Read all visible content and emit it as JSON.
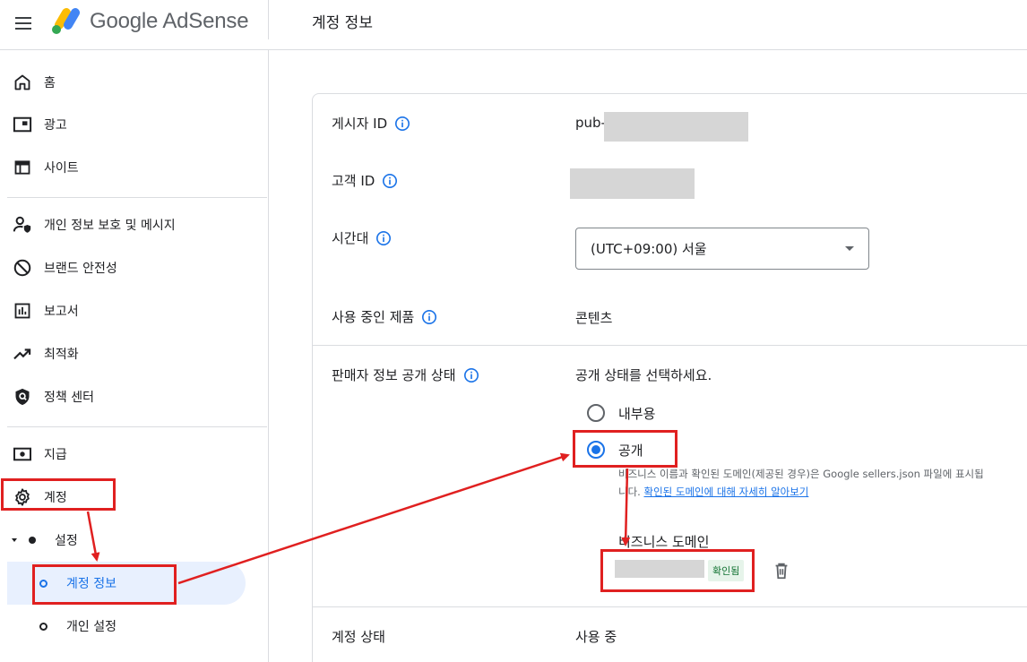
{
  "header": {
    "logo_text": "Google AdSense",
    "page_title": "계정 정보"
  },
  "sidebar": {
    "items": [
      {
        "label": "홈",
        "icon": "home-icon"
      },
      {
        "label": "광고",
        "icon": "ads-icon"
      },
      {
        "label": "사이트",
        "icon": "sites-icon"
      },
      {
        "label": "개인 정보 보호 및 메시지",
        "icon": "privacy-icon"
      },
      {
        "label": "브랜드 안전성",
        "icon": "block-icon"
      },
      {
        "label": "보고서",
        "icon": "reports-icon"
      },
      {
        "label": "최적화",
        "icon": "trending-icon"
      },
      {
        "label": "정책 센터",
        "icon": "policy-icon"
      },
      {
        "label": "지급",
        "icon": "payments-icon"
      },
      {
        "label": "계정",
        "icon": "gear-icon"
      }
    ],
    "settings_label": "설정",
    "sub_items": [
      {
        "label": "계정 정보",
        "active": true
      },
      {
        "label": "개인 설정",
        "active": false
      }
    ]
  },
  "card": {
    "publisher_id_label": "게시자 ID",
    "publisher_id_prefix": "pub-",
    "customer_id_label": "고객 ID",
    "timezone_label": "시간대",
    "timezone_value": "(UTC+09:00) 서울",
    "products_label": "사용 중인 제품",
    "products_value": "콘텐츠",
    "seller_status_label": "판매자 정보 공개 상태",
    "seller_prompt": "공개 상태를 선택하세요.",
    "radio_options": [
      {
        "label": "내부용",
        "checked": false
      },
      {
        "label": "공개",
        "checked": true
      }
    ],
    "helper_text_1": "비즈니스 이름과 확인된 도메인(제공된 경우)은 Google sellers.json 파일에 표시됩니다.",
    "helper_link": "확인된 도메인에 대해 자세히 알아보기",
    "business_domain_label": "비즈니스 도메인",
    "verified_badge": "확인됨",
    "account_status_label": "계정 상태",
    "account_status_value": "사용 중"
  },
  "colors": {
    "accent": "#1a73e8",
    "annotation": "#e02020",
    "active_bg": "#e8f0fe"
  }
}
